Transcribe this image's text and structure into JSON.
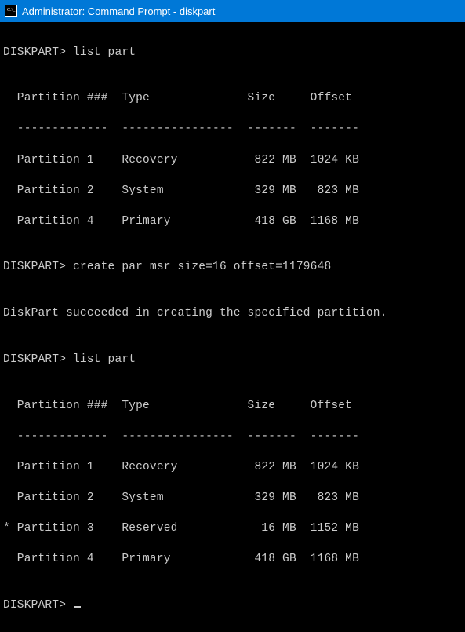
{
  "window": {
    "title": "Administrator: Command Prompt - diskpart"
  },
  "prompt": "DISKPART>",
  "commands": {
    "cmd1": "list part",
    "cmd2": "create par msr size=16 offset=1179648",
    "cmd3": "list part",
    "success_msg": "DiskPart succeeded in creating the specified partition."
  },
  "table1": {
    "header": "  Partition ###  Type              Size     Offset",
    "divider": "  -------------  ----------------  -------  -------",
    "rows": [
      "  Partition 1    Recovery           822 MB  1024 KB",
      "  Partition 2    System             329 MB   823 MB",
      "  Partition 4    Primary            418 GB  1168 MB"
    ]
  },
  "table2": {
    "header": "  Partition ###  Type              Size     Offset",
    "divider": "  -------------  ----------------  -------  -------",
    "rows": [
      "  Partition 1    Recovery           822 MB  1024 KB",
      "  Partition 2    System             329 MB   823 MB",
      "* Partition 3    Reserved            16 MB  1152 MB",
      "  Partition 4    Primary            418 GB  1168 MB"
    ]
  },
  "blank": ""
}
